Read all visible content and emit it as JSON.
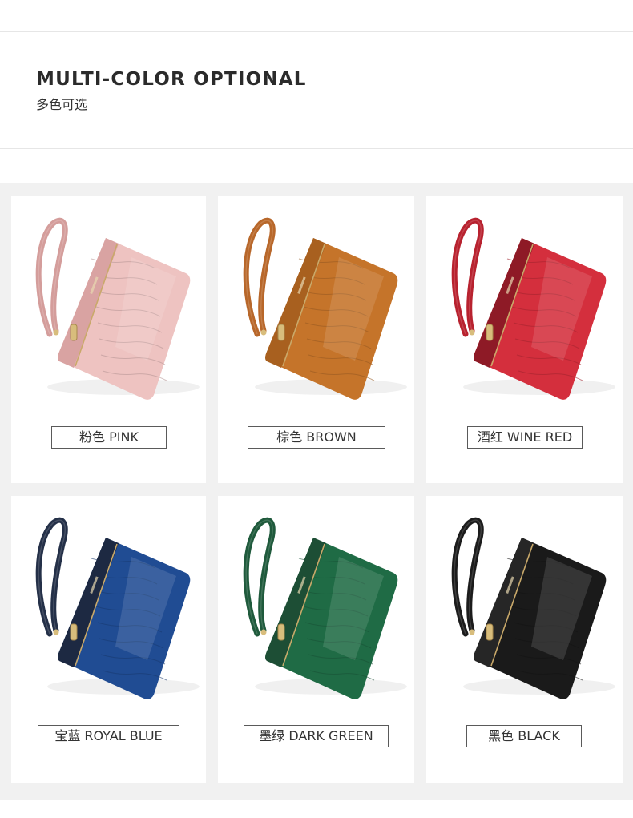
{
  "header": {
    "title": "MULTI-COLOR OPTIONAL",
    "subtitle": "多色可选"
  },
  "products": [
    {
      "label": "粉色 PINK",
      "body_color": "#eec3c1",
      "panel_color": "#d9a3a2",
      "strap_color": "#d49d9b",
      "icon": "pink-wallet-icon"
    },
    {
      "label": "棕色 BROWN",
      "body_color": "#c5742a",
      "panel_color": "#a8601f",
      "strap_color": "#b8672a",
      "icon": "brown-wallet-icon"
    },
    {
      "label": "酒红 WINE RED",
      "body_color": "#d42f3d",
      "panel_color": "#8e1a26",
      "strap_color": "#b8222f",
      "icon": "wine-red-wallet-icon"
    },
    {
      "label": "宝蓝 ROYAL BLUE",
      "body_color": "#204c93",
      "panel_color": "#1d2942",
      "strap_color": "#243048",
      "icon": "royal-blue-wallet-icon"
    },
    {
      "label": "墨绿 DARK GREEN",
      "body_color": "#1f6b45",
      "panel_color": "#1d4e35",
      "strap_color": "#1f5a3c",
      "icon": "dark-green-wallet-icon"
    },
    {
      "label": "黑色 BLACK",
      "body_color": "#1a1a1a",
      "panel_color": "#262626",
      "strap_color": "#1c1c1c",
      "icon": "black-wallet-icon"
    }
  ]
}
